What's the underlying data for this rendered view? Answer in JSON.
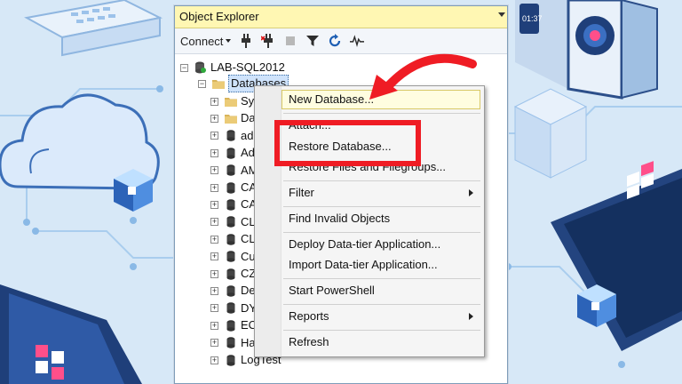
{
  "window": {
    "title": "Object Explorer"
  },
  "toolbar": {
    "connect_label": "Connect",
    "icons": [
      "connect-plug-icon",
      "disconnect-plug-icon",
      "stop-icon",
      "filter-icon",
      "refresh-icon",
      "activity-monitor-icon"
    ]
  },
  "tree": {
    "server": "LAB-SQL2012",
    "databases_label": "Databases",
    "children": [
      "Sys",
      "Da",
      "ad",
      "Ad",
      "AM",
      "CA",
      "CA",
      "CL",
      "CL",
      "Cu",
      "CZ",
      "De",
      "DY",
      "EC",
      "Ha",
      "LogTest"
    ]
  },
  "context_menu": {
    "items": [
      "New Database...",
      "Attach...",
      "Restore Database...",
      "Restore Files and Filegroups...",
      "Filter",
      "Find Invalid Objects",
      "Deploy Data-tier Application...",
      "Import Data-tier Application...",
      "Start PowerShell",
      "Reports",
      "Refresh"
    ]
  },
  "colors": {
    "accent_red": "#ef1c24",
    "title_bar": "#fff7b3",
    "background": "#d7e8f7"
  }
}
